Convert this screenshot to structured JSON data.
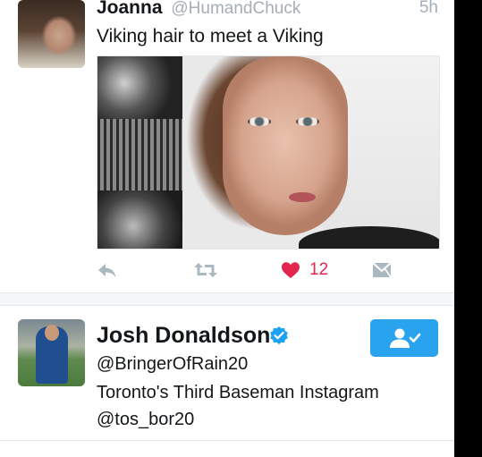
{
  "tweet": {
    "author_name": "Joanna",
    "author_handle": "@HumandChuck",
    "time": "5h",
    "text": "Viking hair to meet a Viking",
    "like_count": "12"
  },
  "user_card": {
    "name": "Josh Donaldson",
    "handle": "@BringerOfRain20",
    "bio_line1": "Toronto's Third Baseman Instagram",
    "bio_line2": "@tos_bor20",
    "verified": true,
    "following": true
  },
  "colors": {
    "like_red": "#e2264d",
    "icon_gray": "#aab8c2",
    "follow_blue": "#2aa3ef",
    "verified_blue": "#1da1f2"
  },
  "icons": [
    "reply-icon",
    "retweet-icon",
    "heart-icon",
    "direct-message-icon",
    "verified-badge-icon",
    "following-person-check-icon"
  ]
}
